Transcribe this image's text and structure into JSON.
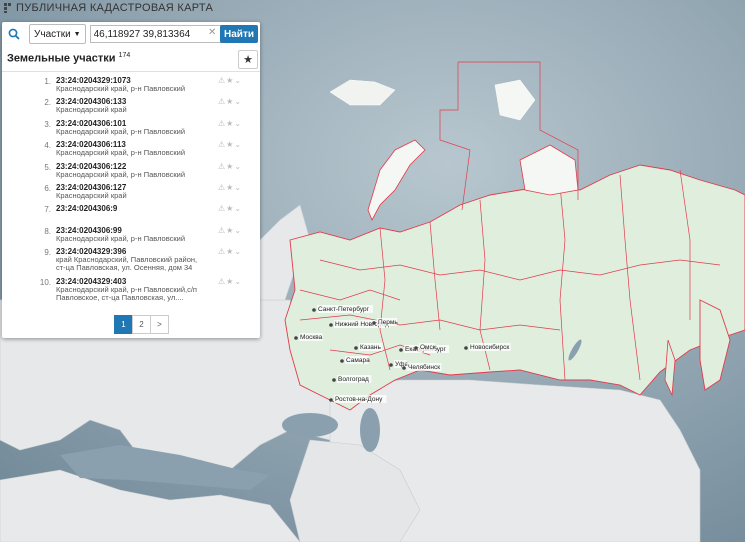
{
  "app": {
    "title": "ПУБЛИЧНАЯ КАДАСТРОВАЯ КАРТА"
  },
  "search": {
    "type_label": "Участки",
    "query": "46,118927 39,813364",
    "find_label": "Найти"
  },
  "results": {
    "header": "Земельные участки",
    "count": "174",
    "items": [
      {
        "num": "1.",
        "cad": "23:24:0204329:1073",
        "addr": [
          "Краснодарский край, р-н Павловский"
        ]
      },
      {
        "num": "2.",
        "cad": "23:24:0204306:133",
        "addr": [
          "Краснодарский край"
        ]
      },
      {
        "num": "3.",
        "cad": "23:24:0204306:101",
        "addr": [
          "Краснодарский край, р-н Павловский"
        ]
      },
      {
        "num": "4.",
        "cad": "23:24:0204306:113",
        "addr": [
          "Краснодарский край, р-н Павловский"
        ]
      },
      {
        "num": "5.",
        "cad": "23:24:0204306:122",
        "addr": [
          "Краснодарский край, р-н Павловский"
        ]
      },
      {
        "num": "6.",
        "cad": "23:24:0204306:127",
        "addr": [
          "Краснодарский край"
        ]
      },
      {
        "num": "7.",
        "cad": "23:24:0204306:9",
        "addr": []
      },
      {
        "num": "8.",
        "cad": "23:24:0204306:99",
        "addr": [
          "Краснодарский край, р-н Павловский"
        ]
      },
      {
        "num": "9.",
        "cad": "23:24:0204329:396",
        "addr": [
          "край Краснодарский, Павловский район,",
          "ст-ца Павловская, ул. Осенняя, дом 34"
        ]
      },
      {
        "num": "10.",
        "cad": "23:24:0204329:403",
        "addr": [
          "Краснодарский край, р-н Павловский,с/п",
          "Павловское, ст-ца Павловская, ул...."
        ]
      }
    ]
  },
  "pager": {
    "pages": [
      "1",
      "2"
    ],
    "next": ">",
    "active": "1"
  },
  "map": {
    "cities": [
      "Санкт-Петербург",
      "Нижний Новгород",
      "Москва",
      "Пермь",
      "Екатеринбург",
      "Казань",
      "Уфа",
      "Омск",
      "Новосибирск",
      "Челябинск",
      "Самара",
      "Волгоград",
      "Ростов-на-Дону"
    ]
  },
  "colors": {
    "accent": "#1f77b4",
    "boundary": "#e23b4b",
    "land_ru": "#dfeedd",
    "water": "#7f97a8"
  },
  "icons": {
    "search": "magnifier",
    "star": "star",
    "clear": "x",
    "caret": "triangle-down"
  }
}
